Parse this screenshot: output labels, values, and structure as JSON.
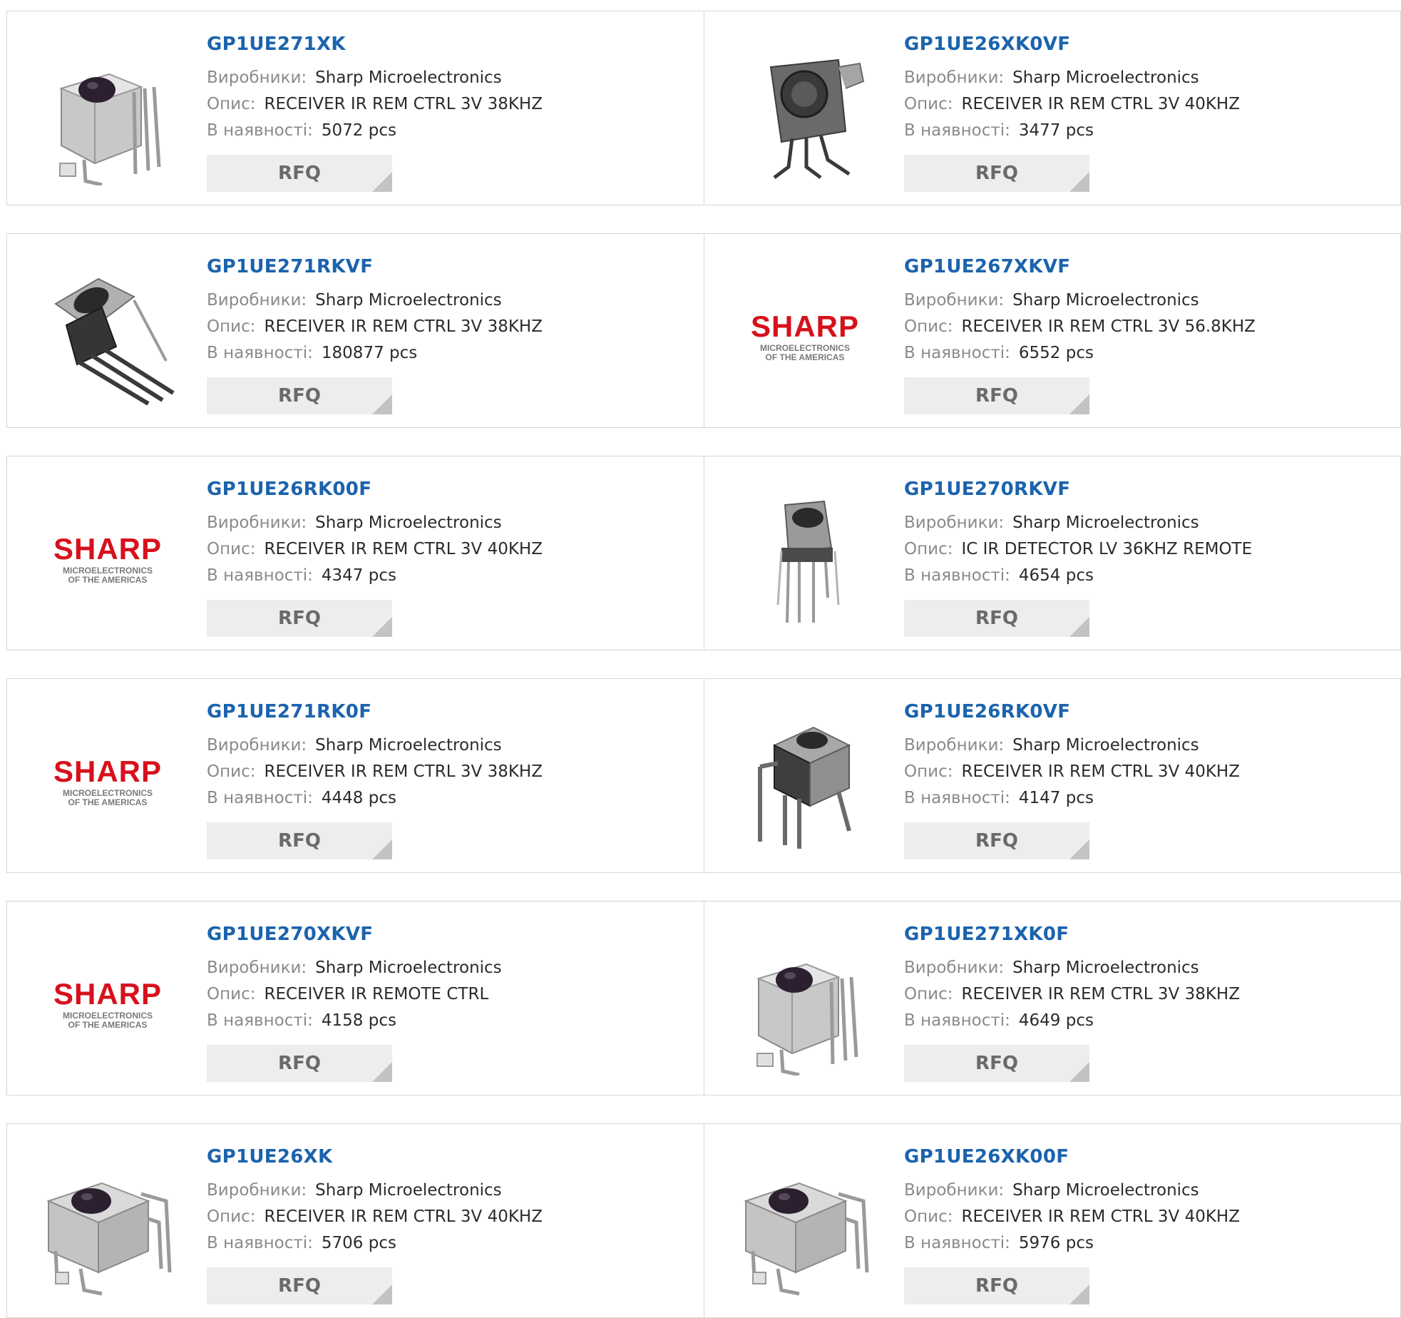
{
  "labels": {
    "manufacturer": "Виробники:",
    "description": "Опис:",
    "stock": "В наявності:",
    "rfq": "RFQ"
  },
  "logo": {
    "brand": "SHARP",
    "line1": "MICROELECTRONICS",
    "line2": "OF THE AMERICAS",
    "brand_color": "#d7101c"
  },
  "colors": {
    "part_link": "#1b63ad",
    "button_bg": "#ededed",
    "button_corner": "#c3c3c3"
  },
  "products": [
    {
      "part": "GP1UE271XK",
      "manufacturer": "Sharp Microelectronics",
      "description": "RECEIVER IR REM CTRL 3V 38KHZ",
      "stock": "5072 pcs",
      "image": "ir-receiver-metal-tall"
    },
    {
      "part": "GP1UE26XK0VF",
      "manufacturer": "Sharp Microelectronics",
      "description": "RECEIVER IR REM CTRL 3V 40KHZ",
      "stock": "3477 pcs",
      "image": "ir-receiver-dark-upright"
    },
    {
      "part": "GP1UE271RKVF",
      "manufacturer": "Sharp Microelectronics",
      "description": "RECEIVER IR REM CTRL 3V 38KHZ",
      "stock": "180877 pcs",
      "image": "ir-receiver-angled"
    },
    {
      "part": "GP1UE267XKVF",
      "manufacturer": "Sharp Microelectronics",
      "description": "RECEIVER IR REM CTRL 3V 56.8KHZ",
      "stock": "6552 pcs",
      "image": "sharp-logo"
    },
    {
      "part": "GP1UE26RK00F",
      "manufacturer": "Sharp Microelectronics",
      "description": "RECEIVER IR REM CTRL 3V 40KHZ",
      "stock": "4347 pcs",
      "image": "sharp-logo"
    },
    {
      "part": "GP1UE270RKVF",
      "manufacturer": "Sharp Microelectronics",
      "description": "IC IR DETECTOR LV 36KHZ REMOTE",
      "stock": "4654 pcs",
      "image": "ir-receiver-thin"
    },
    {
      "part": "GP1UE271RK0F",
      "manufacturer": "Sharp Microelectronics",
      "description": "RECEIVER IR REM CTRL 3V 38KHZ",
      "stock": "4448 pcs",
      "image": "sharp-logo"
    },
    {
      "part": "GP1UE26RK0VF",
      "manufacturer": "Sharp Microelectronics",
      "description": "RECEIVER IR REM CTRL 3V 40KHZ",
      "stock": "4147 pcs",
      "image": "ir-receiver-leads-front"
    },
    {
      "part": "GP1UE270XKVF",
      "manufacturer": "Sharp Microelectronics",
      "description": "RECEIVER IR REMOTE CTRL",
      "stock": "4158 pcs",
      "image": "sharp-logo"
    },
    {
      "part": "GP1UE271XK0F",
      "manufacturer": "Sharp Microelectronics",
      "description": "RECEIVER IR REM CTRL 3V 38KHZ",
      "stock": "4649 pcs",
      "image": "ir-receiver-metal-tall"
    },
    {
      "part": "GP1UE26XK",
      "manufacturer": "Sharp Microelectronics",
      "description": "RECEIVER IR REM CTRL 3V 40KHZ",
      "stock": "5706 pcs",
      "image": "ir-receiver-metal-box"
    },
    {
      "part": "GP1UE26XK00F",
      "manufacturer": "Sharp Microelectronics",
      "description": "RECEIVER IR REM CTRL 3V 40KHZ",
      "stock": "5976 pcs",
      "image": "ir-receiver-metal-box"
    }
  ]
}
